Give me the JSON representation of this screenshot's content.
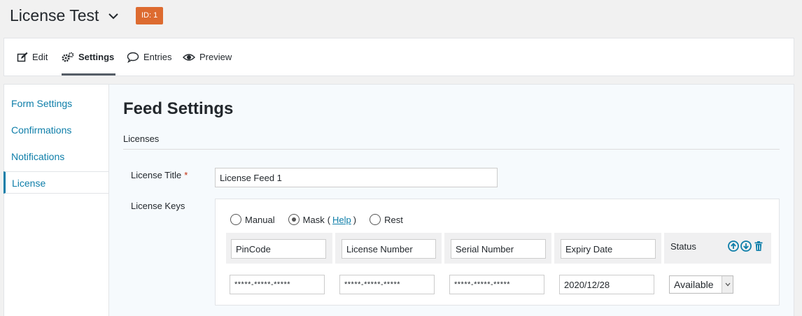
{
  "form": {
    "title": "License Test",
    "id_badge": "ID: 1"
  },
  "toolbar": {
    "edit": "Edit",
    "settings": "Settings",
    "entries": "Entries",
    "preview": "Preview"
  },
  "sidebar": {
    "items": [
      {
        "label": "Form Settings"
      },
      {
        "label": "Confirmations"
      },
      {
        "label": "Notifications"
      },
      {
        "label": "License"
      }
    ],
    "active": "License"
  },
  "main": {
    "title": "Feed Settings",
    "section": "Licenses",
    "license_title_label": "License Title",
    "required_mark": "*",
    "license_title_value": "License Feed 1",
    "license_keys_label": "License Keys",
    "modes": {
      "manual": "Manual",
      "mask": "Mask",
      "help_open": "(",
      "help": "Help",
      "help_close": ")",
      "rest": "Rest",
      "selected": "mask"
    },
    "columns": [
      "PinCode",
      "License Number",
      "Serial Number",
      "Expiry Date"
    ],
    "status_label": "Status",
    "row": {
      "pincode": "*****-*****-*****",
      "license_number": "*****-*****-*****",
      "serial_number": "*****-*****-*****",
      "expiry_date": "2020/12/28",
      "status": "Available"
    },
    "icons": [
      "arrow-up-circle-icon",
      "arrow-down-circle-icon",
      "trash-icon"
    ],
    "colors": {
      "accent": "#0e7ea9",
      "badge": "#dd6b30",
      "required": "#c02b0a"
    }
  }
}
